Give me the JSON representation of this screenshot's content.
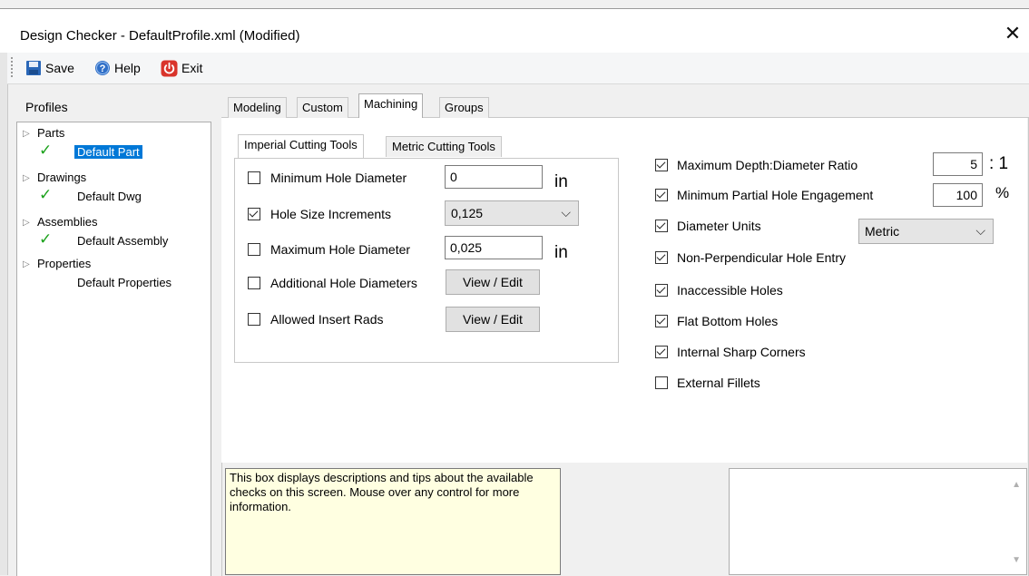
{
  "window": {
    "title": "Design Checker - DefaultProfile.xml (Modified)"
  },
  "toolbar": {
    "save": "Save",
    "help": "Help",
    "exit": "Exit"
  },
  "profiles": {
    "label": "Profiles",
    "tree": [
      {
        "label": "Parts",
        "child": "Default Part"
      },
      {
        "label": "Drawings",
        "child": "Default Dwg"
      },
      {
        "label": "Assemblies",
        "child": "Default Assembly"
      },
      {
        "label": "Properties",
        "child": "Default Properties"
      }
    ]
  },
  "tabs": [
    "Modeling",
    "Custom",
    "Machining",
    "Groups"
  ],
  "active_tab": "Machining",
  "subtabs": [
    "Imperial Cutting Tools",
    "Metric Cutting Tools"
  ],
  "imperial": {
    "min_hole": {
      "label": "Minimum Hole Diameter",
      "checked": false,
      "value": "0",
      "unit": "in"
    },
    "hole_incr": {
      "label": "Hole Size Increments",
      "checked": true,
      "value": "0,125"
    },
    "max_hole": {
      "label": "Maximum Hole Diameter",
      "checked": false,
      "value": "0,025",
      "unit": "in"
    },
    "add_holes": {
      "label": "Additional Hole Diameters",
      "checked": false,
      "button": "View / Edit"
    },
    "insert_rads": {
      "label": "Allowed Insert Rads",
      "checked": false,
      "button": "View / Edit"
    }
  },
  "checks": {
    "max_depth": {
      "label": "Maximum Depth:Diameter Ratio",
      "checked": true,
      "value": "5",
      "suffix": ": 1"
    },
    "min_partial": {
      "label": "Minimum Partial Hole Engagement",
      "checked": true,
      "value": "100",
      "suffix": "%"
    },
    "diam_units": {
      "label": "Diameter Units",
      "checked": true,
      "value": "Metric"
    },
    "non_perp": {
      "label": "Non-Perpendicular Hole Entry",
      "checked": true
    },
    "inaccessible": {
      "label": "Inaccessible Holes",
      "checked": true
    },
    "flat_bottom": {
      "label": "Flat Bottom Holes",
      "checked": true
    },
    "sharp_corners": {
      "label": "Internal Sharp Corners",
      "checked": true
    },
    "ext_fillets": {
      "label": "External Fillets",
      "checked": false
    }
  },
  "help_text": "This box displays descriptions and tips about the available checks on this screen. Mouse over any control for more information.",
  "colors": {
    "selection": "#0078d7",
    "help_bg": "#ffffe1",
    "check_green": "#1aa11a"
  }
}
